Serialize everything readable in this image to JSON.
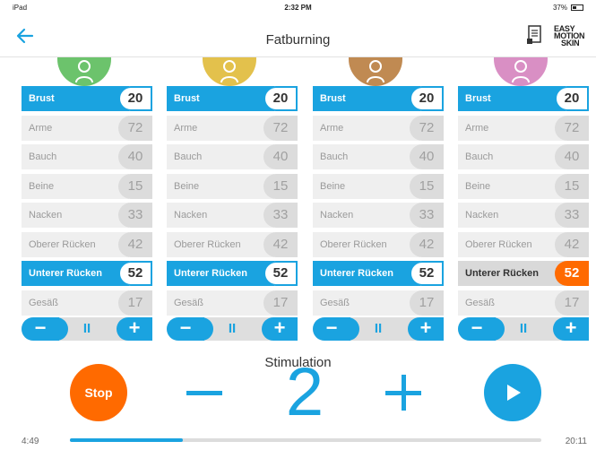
{
  "statusbar": {
    "device": "iPad",
    "time": "2:32 PM",
    "battery": "37%"
  },
  "header": {
    "title": "Fatburning",
    "logo_lines": [
      "EASY",
      "MOTION",
      "SKIN"
    ]
  },
  "colors": {
    "accent": "#1aa3e0",
    "orange": "#ff6a00",
    "avatars": [
      "#6cc36c",
      "#e3c14c",
      "#c08a52",
      "#d98fc4"
    ]
  },
  "columns": [
    {
      "avatar_color": "#6cc36c",
      "rows": [
        {
          "label": "Brust",
          "value": "20",
          "state": "active"
        },
        {
          "label": "Arme",
          "value": "72",
          "state": "normal"
        },
        {
          "label": "Bauch",
          "value": "40",
          "state": "normal"
        },
        {
          "label": "Beine",
          "value": "15",
          "state": "normal"
        },
        {
          "label": "Nacken",
          "value": "33",
          "state": "normal"
        },
        {
          "label": "Oberer Rücken",
          "value": "42",
          "state": "normal"
        },
        {
          "label": "Unterer Rücken",
          "value": "52",
          "state": "active"
        },
        {
          "label": "Gesäß",
          "value": "17",
          "state": "normal"
        }
      ],
      "controls": {
        "minus": "−",
        "pause": "II",
        "plus": "+"
      }
    },
    {
      "avatar_color": "#e3c14c",
      "rows": [
        {
          "label": "Brust",
          "value": "20",
          "state": "active"
        },
        {
          "label": "Arme",
          "value": "72",
          "state": "normal"
        },
        {
          "label": "Bauch",
          "value": "40",
          "state": "normal"
        },
        {
          "label": "Beine",
          "value": "15",
          "state": "normal"
        },
        {
          "label": "Nacken",
          "value": "33",
          "state": "normal"
        },
        {
          "label": "Oberer Rücken",
          "value": "42",
          "state": "normal"
        },
        {
          "label": "Unterer Rücken",
          "value": "52",
          "state": "active"
        },
        {
          "label": "Gesäß",
          "value": "17",
          "state": "normal"
        }
      ],
      "controls": {
        "minus": "−",
        "pause": "II",
        "plus": "+"
      }
    },
    {
      "avatar_color": "#c08a52",
      "rows": [
        {
          "label": "Brust",
          "value": "20",
          "state": "active"
        },
        {
          "label": "Arme",
          "value": "72",
          "state": "normal"
        },
        {
          "label": "Bauch",
          "value": "40",
          "state": "normal"
        },
        {
          "label": "Beine",
          "value": "15",
          "state": "normal"
        },
        {
          "label": "Nacken",
          "value": "33",
          "state": "normal"
        },
        {
          "label": "Oberer Rücken",
          "value": "42",
          "state": "normal"
        },
        {
          "label": "Unterer Rücken",
          "value": "52",
          "state": "active"
        },
        {
          "label": "Gesäß",
          "value": "17",
          "state": "normal"
        }
      ],
      "controls": {
        "minus": "−",
        "pause": "II",
        "plus": "+"
      }
    },
    {
      "avatar_color": "#d98fc4",
      "rows": [
        {
          "label": "Brust",
          "value": "20",
          "state": "active"
        },
        {
          "label": "Arme",
          "value": "72",
          "state": "normal"
        },
        {
          "label": "Bauch",
          "value": "40",
          "state": "normal"
        },
        {
          "label": "Beine",
          "value": "15",
          "state": "normal"
        },
        {
          "label": "Nacken",
          "value": "33",
          "state": "normal"
        },
        {
          "label": "Oberer Rücken",
          "value": "42",
          "state": "normal"
        },
        {
          "label": "Unterer Rücken",
          "value": "52",
          "state": "orange"
        },
        {
          "label": "Gesäß",
          "value": "17",
          "state": "normal"
        }
      ],
      "controls": {
        "minus": "−",
        "pause": "II",
        "plus": "+"
      }
    }
  ],
  "stimulation": {
    "label": "Stimulation",
    "value": "2"
  },
  "buttons": {
    "stop": "Stop"
  },
  "progress": {
    "elapsed": "4:49",
    "total": "20:11",
    "fraction": 0.24
  }
}
